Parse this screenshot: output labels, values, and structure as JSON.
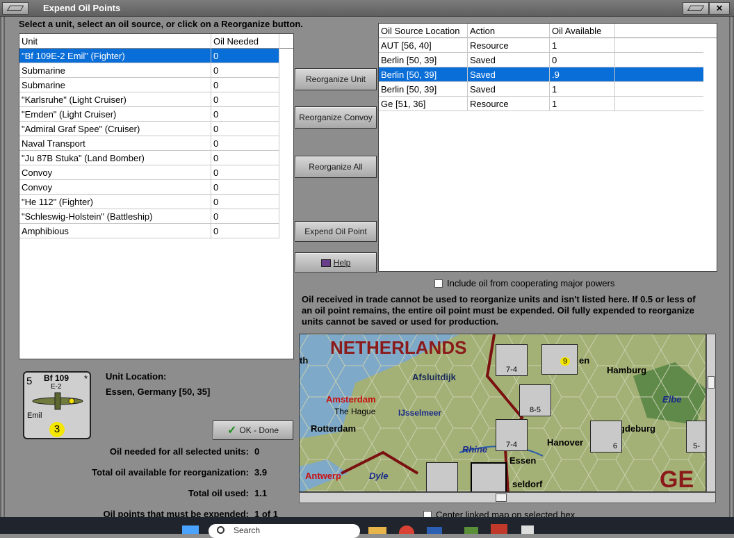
{
  "window": {
    "title": "Expend Oil Points",
    "close_glyph": "✕"
  },
  "prompt": "Select a unit, select an oil source, or click on a Reorganize button.",
  "units_table": {
    "headers": [
      "Unit",
      "Oil Needed"
    ],
    "rows": [
      {
        "unit": "\"Bf 109E-2 Emil\" (Fighter)",
        "oil": "0"
      },
      {
        "unit": "Submarine",
        "oil": "0"
      },
      {
        "unit": "Submarine",
        "oil": "0"
      },
      {
        "unit": "\"Karlsruhe\" (Light Cruiser)",
        "oil": "0"
      },
      {
        "unit": "\"Emden\" (Light Cruiser)",
        "oil": "0"
      },
      {
        "unit": "\"Admiral Graf Spee\" (Cruiser)",
        "oil": "0"
      },
      {
        "unit": "Naval Transport",
        "oil": "0"
      },
      {
        "unit": "\"Ju 87B Stuka\" (Land Bomber)",
        "oil": "0"
      },
      {
        "unit": "Convoy",
        "oil": "0"
      },
      {
        "unit": "Convoy",
        "oil": "0"
      },
      {
        "unit": "\"He 112\" (Fighter)",
        "oil": "0"
      },
      {
        "unit": "\"Schleswig-Holstein\" (Battleship)",
        "oil": "0"
      },
      {
        "unit": "Amphibious",
        "oil": "0"
      }
    ]
  },
  "sources_table": {
    "headers": [
      "Oil Source Location",
      "Action",
      "Oil Available"
    ],
    "rows": [
      {
        "loc": "AUT [56, 40]",
        "action": "Resource",
        "avail": "1"
      },
      {
        "loc": "Berlin [50, 39]",
        "action": "Saved",
        "avail": "0"
      },
      {
        "loc": "Berlin [50, 39]",
        "action": "Saved",
        "avail": ".9"
      },
      {
        "loc": "Berlin [50, 39]",
        "action": "Saved",
        "avail": "1"
      },
      {
        "loc": "Ge [51, 36]",
        "action": "Resource",
        "avail": "1"
      }
    ]
  },
  "buttons": {
    "reorganize_unit": "Reorganize Unit",
    "reorganize_convoy": "Reorganize Convoy",
    "reorganize_all": "Reorganize All",
    "expend_oil": "Expend Oil Point",
    "help": "Help",
    "ok_done": "OK - Done"
  },
  "include_oil_label": "Include oil from cooperating major powers",
  "info_text": "Oil received in trade cannot be used to reorganize units and isn't listed here.  If 0.5 or less of an oil point remains, the entire oil point must be expended.   Oil fully expended to reorganize units cannot be saved or used for production.",
  "unit_card": {
    "strength": "5",
    "name": "Bf 109",
    "model": "E-2",
    "nickname": "Emil",
    "movement": "3",
    "corner_mark": "*"
  },
  "unit_location": {
    "label": "Unit Location:",
    "value": "Essen, Germany [50, 35]"
  },
  "stats": [
    {
      "label": "Oil needed for all selected units:",
      "value": "0"
    },
    {
      "label": "Total oil available for reorganization:",
      "value": "3.9"
    },
    {
      "label": "Total oil used:",
      "value": "1.1"
    },
    {
      "label": "Oil points that must be expended:",
      "value": "1 of 1"
    }
  ],
  "center_map_label": "Center linked map on selected hex",
  "map": {
    "labels": [
      "NETHERLANDS",
      "Afsluitdijk",
      "Amsterdam",
      "The Hague",
      "IJsselmeer",
      "Rotterdam",
      "Rhine",
      "Antwerp",
      "Dyle",
      "Essen",
      "Hanover",
      "Hamburg",
      "Elbe",
      "gdeburg",
      "seldorf",
      "GE",
      "th",
      "en"
    ],
    "counters": [
      "7-4",
      "8-5",
      "7-4",
      "6",
      "5-",
      "9"
    ]
  },
  "taskbar": {
    "search_placeholder": "Search"
  },
  "colors": {
    "selection": "#0a6ed8",
    "map_red_label": "#8b1a1a",
    "title_bar": "#6e6e6e"
  }
}
